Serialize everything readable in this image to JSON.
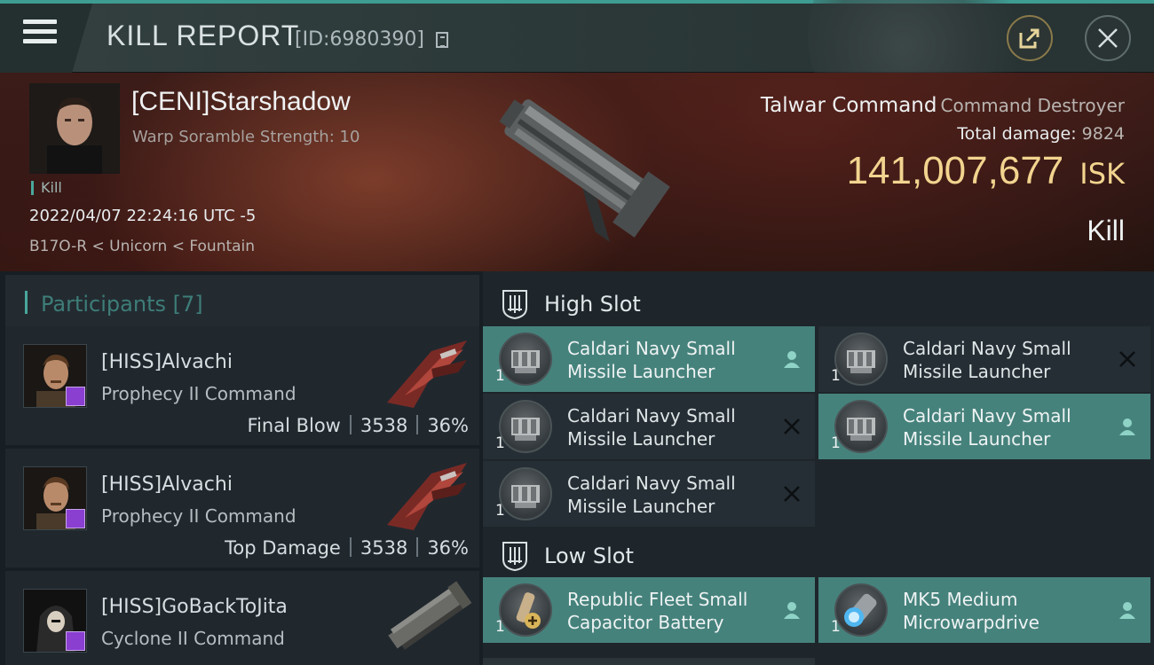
{
  "header": {
    "title": "KILL REPORT",
    "report_id": "[ID:6980390]"
  },
  "victim": {
    "name": "[CENI]Starshadow",
    "scramble": "Warp Soramble Strength: 10",
    "kill_tag": "Kill",
    "date": "2022/04/07 22:24:16 UTC -5",
    "location": "B17O-R < Unicorn < Fountain",
    "ship_name": "Talwar Command",
    "ship_class": "Command Destroyer",
    "damage_label": "Total damage:",
    "damage_value": "9824",
    "isk_value": "141,007,677",
    "isk_unit": "ISK",
    "kill_type": "Kill"
  },
  "participants": {
    "title": "Participants",
    "count": "[7]",
    "rows": [
      {
        "name": "[HISS]Alvachi",
        "ship": "Prophecy II Command",
        "role": "Final Blow",
        "damage": "3538",
        "percent": "36%"
      },
      {
        "name": "[HISS]Alvachi",
        "ship": "Prophecy II Command",
        "role": "Top Damage",
        "damage": "3538",
        "percent": "36%"
      },
      {
        "name": "[HISS]GoBackToJita",
        "ship": "Cyclone II Command"
      }
    ]
  },
  "fitting": {
    "high_slot_title": "High Slot",
    "low_slot_title": "Low Slot",
    "high_slot": [
      {
        "line1": "Caldari Navy Small",
        "line2": "Missile Launcher",
        "qty": "1",
        "status": "dropped"
      },
      {
        "line1": "Caldari Navy Small",
        "line2": "Missile Launcher",
        "qty": "1",
        "status": "destroyed"
      },
      {
        "line1": "Caldari Navy Small",
        "line2": "Missile Launcher",
        "qty": "1",
        "status": "destroyed"
      },
      {
        "line1": "Caldari Navy Small",
        "line2": "Missile Launcher",
        "qty": "1",
        "status": "dropped"
      },
      {
        "line1": "Caldari Navy Small",
        "line2": "Missile Launcher",
        "qty": "1",
        "status": "destroyed"
      }
    ],
    "low_slot": [
      {
        "line1": "Republic Fleet Small",
        "line2": "Capacitor Battery",
        "qty": "1",
        "status": "dropped"
      },
      {
        "line1": "MK5 Medium",
        "line2": "Microwarpdrive",
        "qty": "1",
        "status": "dropped"
      }
    ]
  },
  "colors": {
    "accent": "#4aa79c",
    "isk": "#f2d48f",
    "dropped_bg": "#46827c",
    "badge": "#8a3fd1"
  }
}
